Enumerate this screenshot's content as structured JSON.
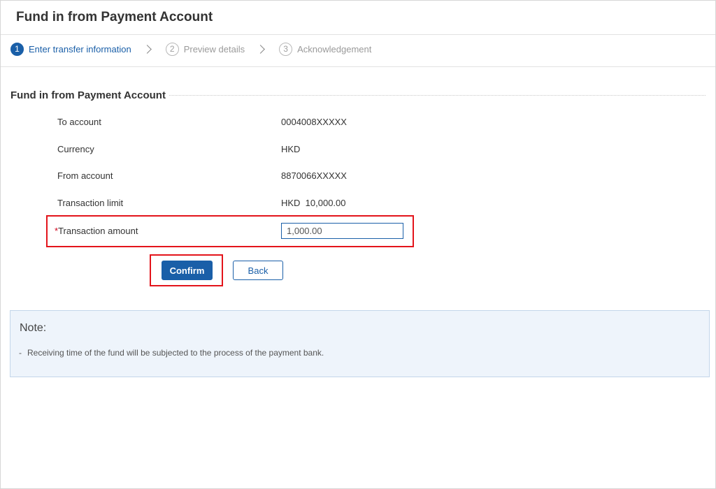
{
  "page": {
    "title": "Fund in from Payment Account"
  },
  "steps": [
    {
      "num": "1",
      "label": "Enter transfer information",
      "state": "active"
    },
    {
      "num": "2",
      "label": "Preview details",
      "state": "inactive"
    },
    {
      "num": "3",
      "label": "Acknowledgement",
      "state": "inactive"
    }
  ],
  "form": {
    "section_title": "Fund in from Payment Account",
    "rows": [
      {
        "label": "To account",
        "value": "0004008XXXXX"
      },
      {
        "label": "Currency",
        "value": "HKD"
      },
      {
        "label": "From account",
        "value": "8870066XXXXX"
      },
      {
        "label": "Transaction limit",
        "value": "HKD  10,000.00"
      }
    ],
    "amount": {
      "required_mark": "*",
      "label": "Transaction amount",
      "value": "1,000.00"
    },
    "confirm_label": "Confirm",
    "back_label": "Back"
  },
  "note": {
    "title": "Note:",
    "dash": "-",
    "text": "Receiving time of the fund will be subjected to the process of the payment bank."
  },
  "colors": {
    "accent": "#1a5fa8",
    "highlight": "#e3141b",
    "note_bg": "#eef4fb"
  }
}
